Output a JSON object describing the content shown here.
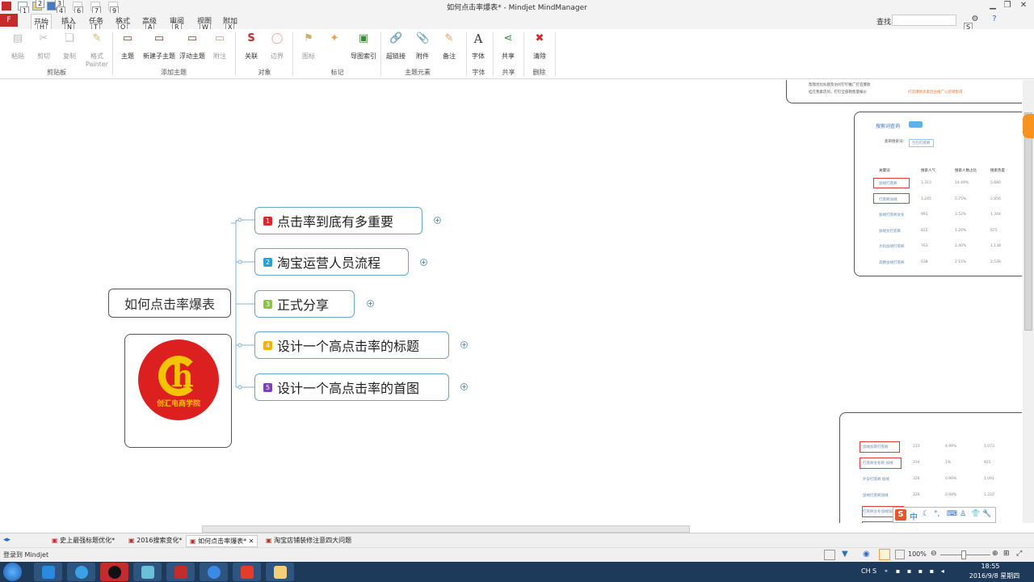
{
  "window": {
    "title": "如何点击率爆表* - Mindjet MindManager",
    "quick_access_keytips": [
      "1",
      "2",
      "3",
      "4",
      "6",
      "7",
      "9"
    ]
  },
  "ribbon_tabs": [
    {
      "label": "F",
      "keytip": ""
    },
    {
      "label": "开始",
      "keytip": "H"
    },
    {
      "label": "插入",
      "keytip": "N"
    },
    {
      "label": "任务",
      "keytip": "T"
    },
    {
      "label": "格式",
      "keytip": "O"
    },
    {
      "label": "高级",
      "keytip": "A"
    },
    {
      "label": "审阅",
      "keytip": "R"
    },
    {
      "label": "视图",
      "keytip": "W"
    },
    {
      "label": "附加",
      "keytip": "X"
    }
  ],
  "find": {
    "label": "查找:",
    "keytip": "S"
  },
  "ribbon": {
    "buttons": {
      "paste": "粘贴",
      "cut": "剪切",
      "copy": "复制",
      "format_painter": "格式\nPainter",
      "topic": "主题",
      "subtopic": "新建子主题",
      "floating": "浮动主题",
      "callout": "附注",
      "relationship": "关联",
      "boundary": "边界",
      "icons": "图标",
      "map_index": "导图索引",
      "hyperlink": "超链接",
      "attachment": "附件",
      "notes": "备注",
      "font": "字体",
      "share": "共享",
      "clear": "清除"
    },
    "groups": {
      "clipboard": "剪贴板",
      "add_topic": "添加主题",
      "objects": "对象",
      "markers": "标记",
      "topic_elements": "主题元素",
      "font": "字体",
      "share": "共享",
      "delete": "删除"
    }
  },
  "map": {
    "central_topic": "如何点击率爆表",
    "logo_text": "创汇电商学院",
    "subtopics": [
      {
        "num": "1",
        "label": "点击率到底有多重要",
        "color": "#d42a2a"
      },
      {
        "num": "2",
        "label": "淘宝运营人员流程",
        "color": "#2a9fd6"
      },
      {
        "num": "3",
        "label": "正式分享",
        "color": "#8bc34a"
      },
      {
        "num": "4",
        "label": "设计一个高点击率的标题",
        "color": "#f0b400"
      },
      {
        "num": "5",
        "label": "设计一个高点击率的首图",
        "color": "#7b3fb8"
      }
    ],
    "expand_symbol": "+"
  },
  "screenshot_card_top": {
    "lines": [
      "帮我优化标题及访问钉钉推广打造爆款",
      "挂在我家店的，钉钉全部销售量报价",
      "打造爆款卖家后台推广以后销售得"
    ]
  },
  "screenshot_card_mid": {
    "title": "搜索词查询",
    "filter_label": "类目搜索词:",
    "filter_value": "包包打底裤",
    "headers": [
      "关键词",
      "搜索人气",
      "搜索人数占比",
      "搜索热度"
    ],
    "rows": [
      [
        "加绒打底裤",
        "1,313",
        "14.49%",
        "5,680"
      ],
      [
        "打底裤加绒",
        "1,245",
        "5.75%",
        "2,856"
      ],
      [
        "加绒打底裤女冬",
        "991",
        "3.52%",
        "1,344"
      ],
      [
        "加绒女打底裤",
        "822",
        "1.20%",
        "675"
      ],
      [
        "大码加绒打底裤",
        "763",
        "2.40%",
        "1,138"
      ],
      [
        "高腰加绒打底裤",
        "638",
        "2.15%",
        "2,538"
      ]
    ]
  },
  "screenshot_card_bottom": {
    "rows": [
      [
        "加绒加厚打底裤",
        "233",
        "4.99%",
        "1,073"
      ],
      [
        "打底裤女冬款 加绒",
        "334",
        "1%",
        "925"
      ],
      [
        "外穿打底裤 加绒",
        "326",
        "0.90%",
        "1,091"
      ],
      [
        "加绒打底裤加绒",
        "326",
        "0.68%",
        "1,222"
      ],
      [
        "打底裤女冬加绒加厚",
        "297",
        "0.78%",
        "862"
      ]
    ]
  },
  "doc_tabs": [
    {
      "label": "史上最强标题优化*"
    },
    {
      "label": "2016搜索变化*"
    },
    {
      "label": "如何点击率爆表*"
    },
    {
      "label": "淘宝店铺装修注意四大问题"
    }
  ],
  "status": {
    "login": "登录到 Mindjet",
    "zoom": "100%"
  },
  "ime_label": "中",
  "taskbar": {
    "time": "18:55",
    "date": "2016/9/8 星期四",
    "lang": "CH"
  }
}
